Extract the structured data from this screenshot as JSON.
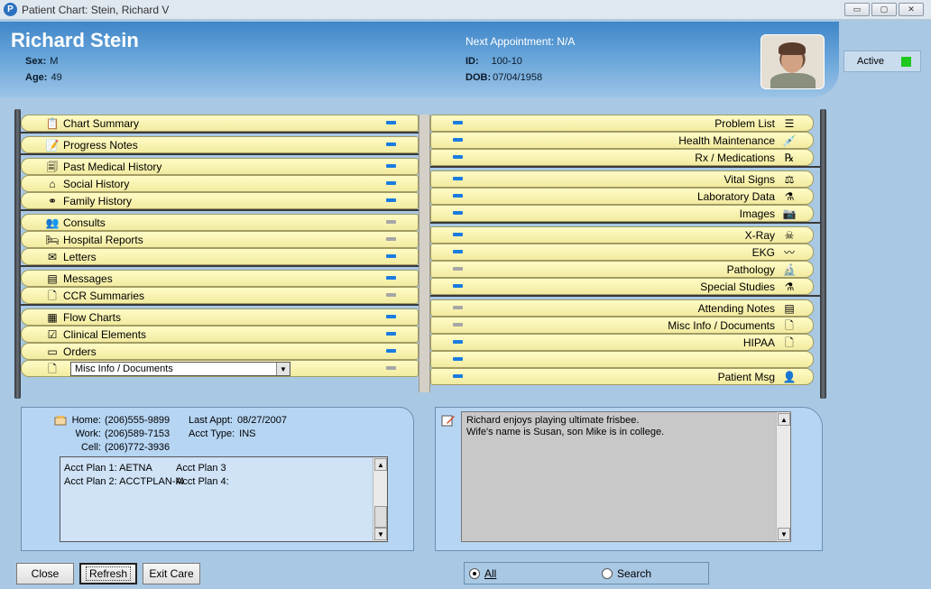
{
  "window": {
    "title": "Patient Chart: Stein, Richard V",
    "app_icon": "app-logo-icon"
  },
  "patient": {
    "name": "Richard Stein",
    "sex_label": "Sex:",
    "sex": "M",
    "age_label": "Age:",
    "age": "49",
    "next_appointment": "Next Appointment: N/A",
    "id_label": "ID:",
    "id": "100-10",
    "dob_label": "DOB:",
    "dob": "07/04/1958",
    "status": "Active",
    "status_color": "#1ec81e"
  },
  "left_tabs": [
    {
      "label": "Chart Summary",
      "icon": "clipboard-icon",
      "indicator": "on"
    },
    {
      "label": "Progress Notes",
      "icon": "pencil-note-icon",
      "indicator": "on"
    },
    {
      "label": "Past Medical History",
      "icon": "document-stack-icon",
      "indicator": "on"
    },
    {
      "label": "Social History",
      "icon": "house-icon",
      "indicator": "on"
    },
    {
      "label": "Family History",
      "icon": "family-tree-icon",
      "indicator": "on"
    },
    {
      "label": "Consults",
      "icon": "people-icon",
      "indicator": "off"
    },
    {
      "label": "Hospital Reports",
      "icon": "hospital-bed-icon",
      "indicator": "off"
    },
    {
      "label": "Letters",
      "icon": "envelope-icon",
      "indicator": "on"
    },
    {
      "label": "Messages",
      "icon": "message-icon",
      "indicator": "on"
    },
    {
      "label": "CCR Summaries",
      "icon": "page-icon",
      "indicator": "off"
    },
    {
      "label": "Flow Charts",
      "icon": "grid-icon",
      "indicator": "on"
    },
    {
      "label": "Clinical Elements",
      "icon": "checkbox-icon",
      "indicator": "on"
    },
    {
      "label": "Orders",
      "icon": "orders-icon",
      "indicator": "on"
    },
    {
      "label": "Misc Info / Documents",
      "icon": "page-icon",
      "indicator": "off",
      "is_select": true
    }
  ],
  "right_tabs": [
    {
      "label": "Problem List",
      "icon": "list-icon",
      "indicator": "on"
    },
    {
      "label": "Health Maintenance",
      "icon": "syringe-icon",
      "indicator": "on"
    },
    {
      "label": "Rx / Medications",
      "icon": "rx-icon",
      "indicator": "on"
    },
    {
      "label": "Vital Signs",
      "icon": "scale-icon",
      "indicator": "on"
    },
    {
      "label": "Laboratory Data",
      "icon": "flask-icon",
      "indicator": "on"
    },
    {
      "label": "Images",
      "icon": "camera-icon",
      "indicator": "on"
    },
    {
      "label": "X-Ray",
      "icon": "xray-icon",
      "indicator": "on"
    },
    {
      "label": "EKG",
      "icon": "ekg-icon",
      "indicator": "on"
    },
    {
      "label": "Pathology",
      "icon": "microscope-icon",
      "indicator": "off"
    },
    {
      "label": "Special Studies",
      "icon": "beaker-icon",
      "indicator": "on"
    },
    {
      "label": "Attending Notes",
      "icon": "message-icon",
      "indicator": "off"
    },
    {
      "label": "Misc Info / Documents",
      "icon": "page-icon",
      "indicator": "off"
    },
    {
      "label": "HIPAA",
      "icon": "page-icon",
      "indicator": "on"
    },
    {
      "label": "",
      "icon": "",
      "indicator": "on"
    },
    {
      "label": "Patient Msg",
      "icon": "people-message-icon",
      "indicator": "on"
    }
  ],
  "contact": {
    "home_label": "Home:",
    "home": "(206)555-9899",
    "work_label": "Work:",
    "work": "(206)589-7153",
    "cell_label": "Cell:",
    "cell": "(206)772-3936",
    "last_appt_label": "Last Appt:",
    "last_appt": "08/27/2007",
    "acct_type_label": "Acct Type:",
    "acct_type": "INS"
  },
  "acct_plans": {
    "plan1": "Acct Plan 1: AETNA",
    "plan3": "Acct Plan 3",
    "plan2": "Acct Plan 2: ACCTPLAN-M",
    "plan4": "Acct Plan 4:"
  },
  "notes": {
    "text": "Richard enjoys playing ultimate frisbee.\nWife's name is Susan, son Mike is in college."
  },
  "buttons": {
    "close": "Close",
    "refresh": "Refresh",
    "exit_care": "Exit Care"
  },
  "filter": {
    "all": "All",
    "search": "Search",
    "selected": "All"
  }
}
